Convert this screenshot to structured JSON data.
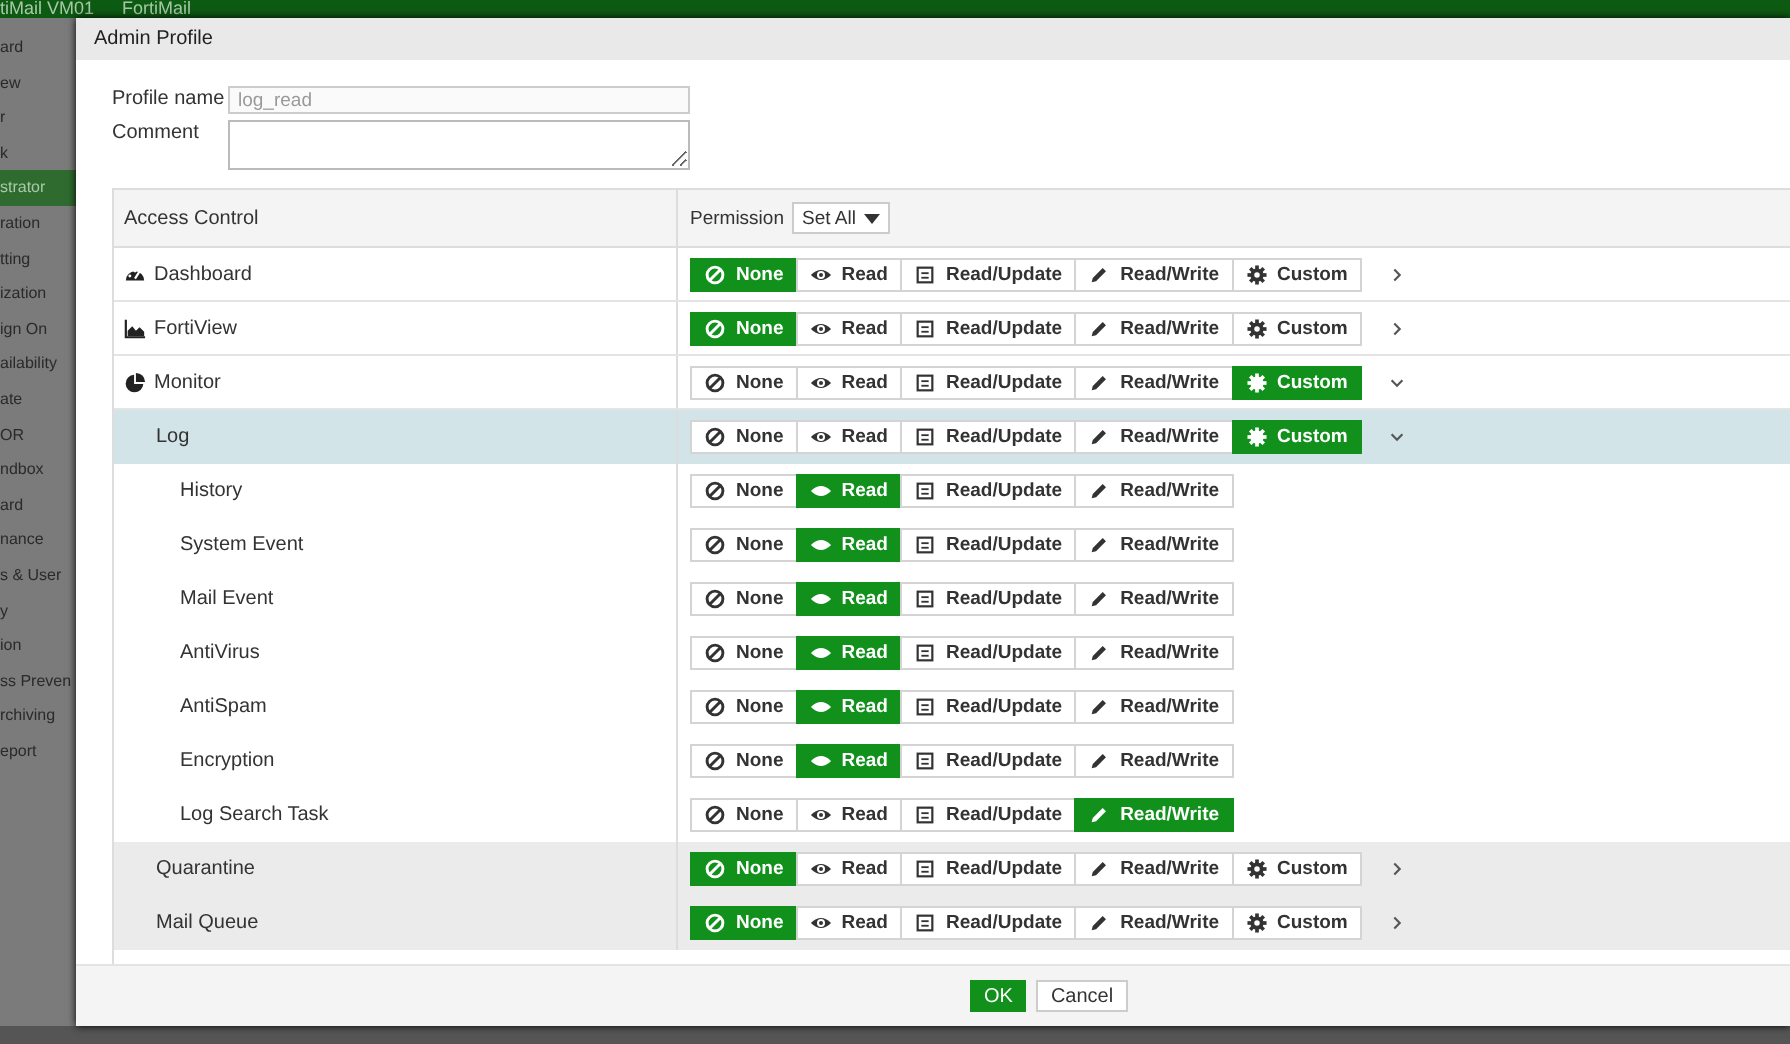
{
  "top_bar": {
    "title": "tiMail VM01",
    "product": "FortiMail"
  },
  "sidebar": {
    "items": [
      {
        "label": "ard",
        "selected": false
      },
      {
        "label": "ew",
        "selected": false
      },
      {
        "label": "r",
        "selected": false
      },
      {
        "label": "k",
        "selected": false
      },
      {
        "label": "strator",
        "selected": true
      },
      {
        "label": "ration",
        "selected": false
      },
      {
        "label": "tting",
        "selected": false
      },
      {
        "label": "ization",
        "selected": false
      },
      {
        "label": "ign On",
        "selected": false
      },
      {
        "label": "ailability",
        "selected": false
      },
      {
        "label": "ate",
        "selected": false
      },
      {
        "label": "OR",
        "selected": false
      },
      {
        "label": "ndbox",
        "selected": false
      },
      {
        "label": "ard",
        "selected": false
      },
      {
        "label": "nance",
        "selected": false
      },
      {
        "label": "s & User",
        "selected": false
      },
      {
        "label": "y",
        "selected": false
      },
      {
        "label": "ion",
        "selected": false
      },
      {
        "label": "ss Preven",
        "selected": false
      },
      {
        "label": "rchiving",
        "selected": false
      },
      {
        "label": "eport",
        "selected": false
      }
    ]
  },
  "dialog": {
    "title": "Admin Profile",
    "profile_name": {
      "label": "Profile name",
      "value": "log_read"
    },
    "comment": {
      "label": "Comment"
    },
    "table": {
      "columns": [
        "Access Control",
        "Permission"
      ],
      "set_all": "Set All",
      "rows": [
        {
          "label": "Dashboard",
          "selected": false,
          "shaded": false,
          "expanded": false,
          "options": [
            {
              "label": "None",
              "kind": "none",
              "selected": true
            },
            {
              "label": "Read",
              "kind": "read",
              "selected": false
            },
            {
              "label": "Read/Update",
              "kind": "update",
              "selected": false
            },
            {
              "label": "Read/Write",
              "kind": "write",
              "selected": false
            },
            {
              "label": "Custom",
              "kind": "custom",
              "selected": false
            }
          ]
        },
        {
          "label": "FortiView",
          "selected": false,
          "shaded": false,
          "expanded": false,
          "options": [
            {
              "label": "None",
              "kind": "none",
              "selected": true
            },
            {
              "label": "Read",
              "kind": "read",
              "selected": false
            },
            {
              "label": "Read/Update",
              "kind": "update",
              "selected": false
            },
            {
              "label": "Read/Write",
              "kind": "write",
              "selected": false
            },
            {
              "label": "Custom",
              "kind": "custom",
              "selected": false
            }
          ]
        },
        {
          "label": "Monitor",
          "selected": false,
          "shaded": false,
          "expanded": true,
          "options": [
            {
              "label": "None",
              "kind": "none",
              "selected": false
            },
            {
              "label": "Read",
              "kind": "read",
              "selected": false
            },
            {
              "label": "Read/Update",
              "kind": "update",
              "selected": false
            },
            {
              "label": "Read/Write",
              "kind": "write",
              "selected": false
            },
            {
              "label": "Custom",
              "kind": "custom",
              "selected": true
            }
          ],
          "children": [
            {
              "label": "Log",
              "selected": true,
              "shaded": false,
              "expanded": true,
              "options": [
                {
                  "label": "None",
                  "kind": "none",
                  "selected": false
                },
                {
                  "label": "Read",
                  "kind": "read",
                  "selected": false
                },
                {
                  "label": "Read/Update",
                  "kind": "update",
                  "selected": false
                },
                {
                  "label": "Read/Write",
                  "kind": "write",
                  "selected": false
                },
                {
                  "label": "Custom",
                  "kind": "custom",
                  "selected": true
                }
              ],
              "children": [
                {
                  "label": "History",
                  "selected": false,
                  "shaded": false,
                  "options": [
                    {
                      "label": "None",
                      "kind": "none",
                      "selected": false
                    },
                    {
                      "label": "Read",
                      "kind": "read",
                      "selected": true
                    },
                    {
                      "label": "Read/Update",
                      "kind": "update",
                      "selected": false
                    },
                    {
                      "label": "Read/Write",
                      "kind": "write",
                      "selected": false
                    }
                  ]
                },
                {
                  "label": "System Event",
                  "selected": false,
                  "shaded": false,
                  "options": [
                    {
                      "label": "None",
                      "kind": "none",
                      "selected": false
                    },
                    {
                      "label": "Read",
                      "kind": "read",
                      "selected": true
                    },
                    {
                      "label": "Read/Update",
                      "kind": "update",
                      "selected": false
                    },
                    {
                      "label": "Read/Write",
                      "kind": "write",
                      "selected": false
                    }
                  ]
                },
                {
                  "label": "Mail Event",
                  "selected": false,
                  "shaded": false,
                  "options": [
                    {
                      "label": "None",
                      "kind": "none",
                      "selected": false
                    },
                    {
                      "label": "Read",
                      "kind": "read",
                      "selected": true
                    },
                    {
                      "label": "Read/Update",
                      "kind": "update",
                      "selected": false
                    },
                    {
                      "label": "Read/Write",
                      "kind": "write",
                      "selected": false
                    }
                  ]
                },
                {
                  "label": "AntiVirus",
                  "selected": false,
                  "shaded": false,
                  "options": [
                    {
                      "label": "None",
                      "kind": "none",
                      "selected": false
                    },
                    {
                      "label": "Read",
                      "kind": "read",
                      "selected": true
                    },
                    {
                      "label": "Read/Update",
                      "kind": "update",
                      "selected": false
                    },
                    {
                      "label": "Read/Write",
                      "kind": "write",
                      "selected": false
                    }
                  ]
                },
                {
                  "label": "AntiSpam",
                  "selected": false,
                  "shaded": false,
                  "options": [
                    {
                      "label": "None",
                      "kind": "none",
                      "selected": false
                    },
                    {
                      "label": "Read",
                      "kind": "read",
                      "selected": true
                    },
                    {
                      "label": "Read/Update",
                      "kind": "update",
                      "selected": false
                    },
                    {
                      "label": "Read/Write",
                      "kind": "write",
                      "selected": false
                    }
                  ]
                },
                {
                  "label": "Encryption",
                  "selected": false,
                  "shaded": false,
                  "options": [
                    {
                      "label": "None",
                      "kind": "none",
                      "selected": false
                    },
                    {
                      "label": "Read",
                      "kind": "read",
                      "selected": true
                    },
                    {
                      "label": "Read/Update",
                      "kind": "update",
                      "selected": false
                    },
                    {
                      "label": "Read/Write",
                      "kind": "write",
                      "selected": false
                    }
                  ]
                },
                {
                  "label": "Log Search Task",
                  "selected": false,
                  "shaded": false,
                  "options": [
                    {
                      "label": "None",
                      "kind": "none",
                      "selected": false
                    },
                    {
                      "label": "Read",
                      "kind": "read",
                      "selected": false
                    },
                    {
                      "label": "Read/Update",
                      "kind": "update",
                      "selected": false
                    },
                    {
                      "label": "Read/Write",
                      "kind": "write",
                      "selected": true
                    }
                  ]
                }
              ]
            },
            {
              "label": "Quarantine",
              "selected": false,
              "shaded": true,
              "expanded": false,
              "options": [
                {
                  "label": "None",
                  "kind": "none",
                  "selected": true
                },
                {
                  "label": "Read",
                  "kind": "read",
                  "selected": false
                },
                {
                  "label": "Read/Update",
                  "kind": "update",
                  "selected": false
                },
                {
                  "label": "Read/Write",
                  "kind": "write",
                  "selected": false
                },
                {
                  "label": "Custom",
                  "kind": "custom",
                  "selected": false
                }
              ]
            },
            {
              "label": "Mail Queue",
              "selected": false,
              "shaded": true,
              "expanded": false,
              "options": [
                {
                  "label": "None",
                  "kind": "none",
                  "selected": true
                },
                {
                  "label": "Read",
                  "kind": "read",
                  "selected": false
                },
                {
                  "label": "Read/Update",
                  "kind": "update",
                  "selected": false
                },
                {
                  "label": "Read/Write",
                  "kind": "write",
                  "selected": false
                },
                {
                  "label": "Custom",
                  "kind": "custom",
                  "selected": false
                }
              ]
            }
          ]
        }
      ]
    },
    "buttons": [
      {
        "label": "OK",
        "kind": "primary"
      },
      {
        "label": "Cancel",
        "kind": "secondary"
      }
    ]
  }
}
